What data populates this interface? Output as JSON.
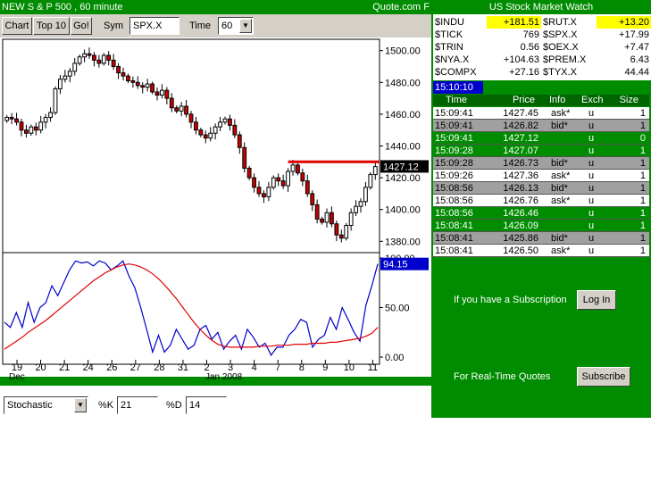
{
  "chart_window": {
    "title": "NEW S & P 500 , 60 minute",
    "brand": "Quote.com",
    "corner_letter": "F"
  },
  "toolbar": {
    "chart_label": "Chart",
    "top10_label": "Top 10",
    "go_label": "Go!",
    "sym_label": "Sym",
    "sym_value": "SPX.X",
    "time_label": "Time",
    "time_value": "60"
  },
  "indicator_bar": {
    "indicator_value": "Stochastic",
    "k_label": "%K",
    "k_value": "21",
    "d_label": "%D",
    "d_value": "14"
  },
  "colors": {
    "green": "#008c00",
    "dark_green_row": "#008c00",
    "gray_row": "#a0a0a0",
    "yellow": "#ffff00",
    "blue": "#0000cc",
    "red_line": "#e00000"
  },
  "chart_data": [
    {
      "type": "candlestick",
      "price_axis_ticks": [
        "1500.00",
        "1480.00",
        "1460.00",
        "1440.00",
        "1420.00",
        "1400.00",
        "1380.00"
      ],
      "ylim": [
        1374,
        1506
      ],
      "last_price_label": "1427.12",
      "level_line_value": 1430,
      "x_ticks": [
        "19",
        "20",
        "21",
        "24",
        "26",
        "27",
        "28",
        "31",
        "2",
        "3",
        "4",
        "7",
        "8",
        "9",
        "10",
        "11"
      ],
      "x_sub_labels": [
        "Dec",
        "Jan 2008"
      ],
      "closes": [
        1458,
        1457,
        1455,
        1450,
        1448,
        1452,
        1450,
        1455,
        1458,
        1461,
        1476,
        1482,
        1484,
        1487,
        1492,
        1496,
        1498,
        1497,
        1494,
        1492,
        1497,
        1494,
        1490,
        1486,
        1484,
        1481,
        1480,
        1478,
        1477,
        1479,
        1474,
        1472,
        1475,
        1470,
        1464,
        1462,
        1465,
        1460,
        1455,
        1450,
        1447,
        1445,
        1448,
        1452,
        1455,
        1457,
        1453,
        1447,
        1439,
        1426,
        1420,
        1414,
        1410,
        1408,
        1414,
        1420,
        1418,
        1415,
        1424,
        1428,
        1423,
        1418,
        1410,
        1403,
        1394,
        1392,
        1398,
        1391,
        1384,
        1382,
        1390,
        1398,
        1402,
        1405,
        1414,
        1422,
        1427
      ]
    },
    {
      "type": "line",
      "title": "Stochastic",
      "y_ticks": [
        "100.00",
        "50.00",
        "0.00"
      ],
      "ylim": [
        0,
        100
      ],
      "last_value_label": "94.15",
      "series": [
        {
          "color": "#0000cc",
          "values": [
            35,
            30,
            45,
            30,
            55,
            35,
            50,
            55,
            72,
            62,
            75,
            88,
            97,
            95,
            96,
            92,
            97,
            95,
            88,
            92,
            97,
            82,
            70,
            50,
            28,
            5,
            22,
            5,
            12,
            28,
            18,
            8,
            12,
            28,
            32,
            18,
            25,
            8,
            16,
            22,
            8,
            28,
            20,
            10,
            14,
            2,
            10,
            10,
            22,
            28,
            38,
            35,
            10,
            18,
            22,
            40,
            28,
            50,
            38,
            25,
            16,
            52,
            72,
            94
          ]
        },
        {
          "color": "#e00000",
          "values": [
            8,
            12,
            16,
            20,
            25,
            29,
            33,
            37,
            42,
            47,
            52,
            57,
            62,
            67,
            72,
            77,
            81,
            85,
            88,
            91,
            93,
            94,
            93,
            91,
            88,
            84,
            79,
            73,
            66,
            59,
            51,
            43,
            35,
            28,
            22,
            17,
            13,
            11,
            10,
            10,
            10,
            10,
            10,
            11,
            11,
            11,
            12,
            12,
            12,
            13,
            13,
            13,
            14,
            14,
            14,
            15,
            15,
            16,
            17,
            18,
            19,
            21,
            24,
            30
          ]
        }
      ]
    }
  ],
  "stock_watch": {
    "title": "US Stock Market Watch",
    "rows": [
      {
        "sym1": "$INDU",
        "val1": "+181.51",
        "sym2": "$RUT.X",
        "val2": "+13.20"
      },
      {
        "sym1": "$TICK",
        "val1": "769",
        "sym2": "$SPX.X",
        "val2": "+17.99"
      },
      {
        "sym1": "$TRIN",
        "val1": "0.56",
        "sym2": "$OEX.X",
        "val2": "+7.47"
      },
      {
        "sym1": "$NYA.X",
        "val1": "+104.63",
        "sym2": "$PREM.X",
        "val2": "6.43"
      },
      {
        "sym1": "$COMPX",
        "val1": "+27.16",
        "sym2": "$TYX.X",
        "val2": "44.44"
      }
    ]
  },
  "clock": "15:10:10",
  "time_sales": {
    "headers": [
      "Time",
      "Price",
      "Info",
      "Exch",
      "Size"
    ],
    "rows": [
      {
        "time": "15:09:41",
        "price": "1427.45",
        "info": "ask*",
        "exch": "u",
        "size": "1",
        "style": "white"
      },
      {
        "time": "15:09:41",
        "price": "1426.82",
        "info": "bid*",
        "exch": "u",
        "size": "1",
        "style": "gray"
      },
      {
        "time": "15:09:41",
        "price": "1427.12",
        "info": "",
        "exch": "u",
        "size": "0",
        "style": "green"
      },
      {
        "time": "15:09:28",
        "price": "1427.07",
        "info": "",
        "exch": "u",
        "size": "1",
        "style": "green"
      },
      {
        "time": "15:09:28",
        "price": "1426.73",
        "info": "bid*",
        "exch": "u",
        "size": "1",
        "style": "gray"
      },
      {
        "time": "15:09:26",
        "price": "1427.36",
        "info": "ask*",
        "exch": "u",
        "size": "1",
        "style": "white"
      },
      {
        "time": "15:08:56",
        "price": "1426.13",
        "info": "bid*",
        "exch": "u",
        "size": "1",
        "style": "gray"
      },
      {
        "time": "15:08:56",
        "price": "1426.76",
        "info": "ask*",
        "exch": "u",
        "size": "1",
        "style": "white"
      },
      {
        "time": "15:08:56",
        "price": "1426.46",
        "info": "",
        "exch": "u",
        "size": "1",
        "style": "green"
      },
      {
        "time": "15:08:41",
        "price": "1426.09",
        "info": "",
        "exch": "u",
        "size": "1",
        "style": "green"
      },
      {
        "time": "15:08:41",
        "price": "1425.86",
        "info": "bid*",
        "exch": "u",
        "size": "1",
        "style": "gray"
      },
      {
        "time": "15:08:41",
        "price": "1426.50",
        "info": "ask*",
        "exch": "u",
        "size": "1",
        "style": "white"
      }
    ]
  },
  "subscription": {
    "label": "If you have a Subscription",
    "login_button": "Log In",
    "realtime_label": "For Real-Time Quotes",
    "subscribe_button": "Subscribe"
  }
}
